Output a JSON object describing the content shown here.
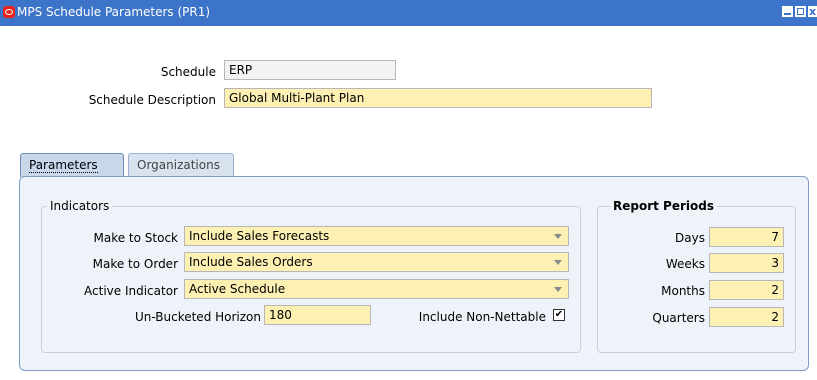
{
  "window": {
    "title": "MPS Schedule Parameters (PR1)",
    "close_glyph": "x"
  },
  "header": {
    "schedule_label": "Schedule",
    "schedule_value": "ERP",
    "description_label": "Schedule Description",
    "description_value": "Global Multi-Plant Plan"
  },
  "tabs": [
    {
      "label": "Parameters",
      "active": true
    },
    {
      "label": "Organizations",
      "active": false
    }
  ],
  "indicators": {
    "group_label": "Indicators",
    "make_to_stock_label": "Make to Stock",
    "make_to_stock_value": "Include Sales Forecasts",
    "make_to_order_label": "Make to Order",
    "make_to_order_value": "Include Sales Orders",
    "active_indicator_label": "Active Indicator",
    "active_indicator_value": "Active Schedule",
    "horizon_label": "Un-Bucketed Horizon",
    "horizon_value": "180",
    "non_nettable_label": "Include Non-Nettable",
    "non_nettable_checked": true,
    "check_glyph": "✔"
  },
  "report_periods": {
    "group_label": "Report Periods",
    "days_label": "Days",
    "days_value": "7",
    "weeks_label": "Weeks",
    "weeks_value": "3",
    "months_label": "Months",
    "months_value": "2",
    "quarters_label": "Quarters",
    "quarters_value": "2"
  },
  "colors": {
    "titlebar": "#3b74c8",
    "field_required": "#fcf0b3",
    "panel": "#eef3fa"
  }
}
